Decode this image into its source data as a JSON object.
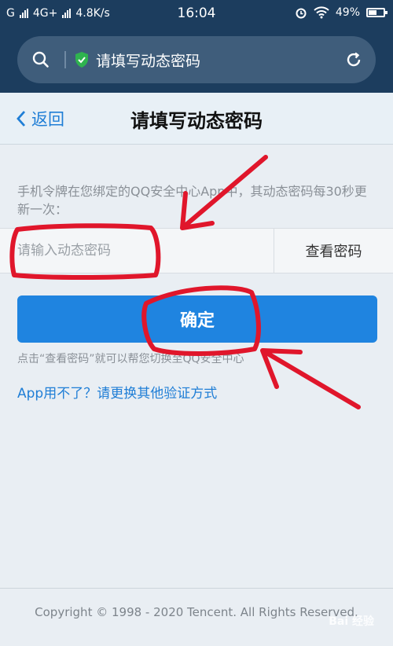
{
  "status_bar": {
    "carrier": "G",
    "network": "4G+",
    "speed": "4.8K/s",
    "time": "16:04",
    "battery": "49%"
  },
  "browser": {
    "page_title": "请填写动态密码"
  },
  "header": {
    "back_label": "返回",
    "title": "请填写动态密码"
  },
  "form": {
    "hint": "手机令牌在您绑定的QQ安全中心App中，其动态密码每30秒更新一次：",
    "placeholder": "请输入动态密码",
    "view_password": "查看密码",
    "confirm": "确定",
    "note": "点击“查看密码”就可以帮您切换至QQ安全中心",
    "alt_link": "App用不了？请更换其他验证方式"
  },
  "footer": {
    "copyright": "Copyright © 1998 - 2020 Tencent. All Rights Reserved.",
    "watermark": "Bai 经验"
  },
  "colors": {
    "accent": "#1f84e0",
    "annotation": "#e0162b",
    "topbar": "#1c3d5e"
  }
}
